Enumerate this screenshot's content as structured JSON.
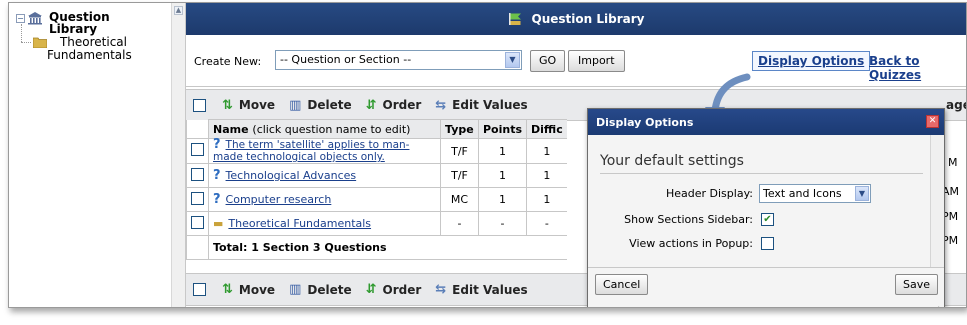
{
  "tree": {
    "root_label": "Question Library",
    "child_label": "Theoretical Fundamentals"
  },
  "header": {
    "title": "Question Library"
  },
  "create": {
    "label": "Create New:",
    "select_value": "-- Question or Section --",
    "go_label": "GO",
    "import_label": "Import",
    "display_options_label": "Display Options",
    "back_label": "Back to Quizzes"
  },
  "toolbar": {
    "move": "Move",
    "delete": "Delete",
    "order": "Order",
    "edit_values": "Edit Values",
    "page_fragment": "age"
  },
  "table": {
    "headers": {
      "name": "Name",
      "name_hint": "(click question name to edit)",
      "type": "Type",
      "points": "Points",
      "difficulty": "Diffic"
    },
    "rows": [
      {
        "name": "The term 'satellite' applies to man-made technological objects only.",
        "type": "T/F",
        "points": "1",
        "diff": "1",
        "right": "M"
      },
      {
        "name": "Technological Advances",
        "type": "T/F",
        "points": "1",
        "diff": "1",
        "right": "AM"
      },
      {
        "name": "Computer research",
        "type": "MC",
        "points": "1",
        "diff": "1",
        "right": "PM"
      },
      {
        "name": "Theoretical Fundamentals",
        "type": "-",
        "points": "-",
        "diff": "-",
        "right": "PM"
      }
    ],
    "total": "Total: 1 Section  3 Questions"
  },
  "dialog": {
    "title": "Display Options",
    "heading": "Your default settings",
    "header_display_label": "Header Display:",
    "header_display_value": "Text and Icons",
    "sidebar_label": "Show Sections Sidebar:",
    "sidebar_checked": true,
    "popup_label": "View actions in Popup:",
    "popup_checked": false,
    "cancel": "Cancel",
    "save": "Save"
  },
  "colors": {
    "header_bg": "#1d3a6c",
    "link": "#1a3f8c",
    "toolbar_bg": "#e9eaec"
  }
}
